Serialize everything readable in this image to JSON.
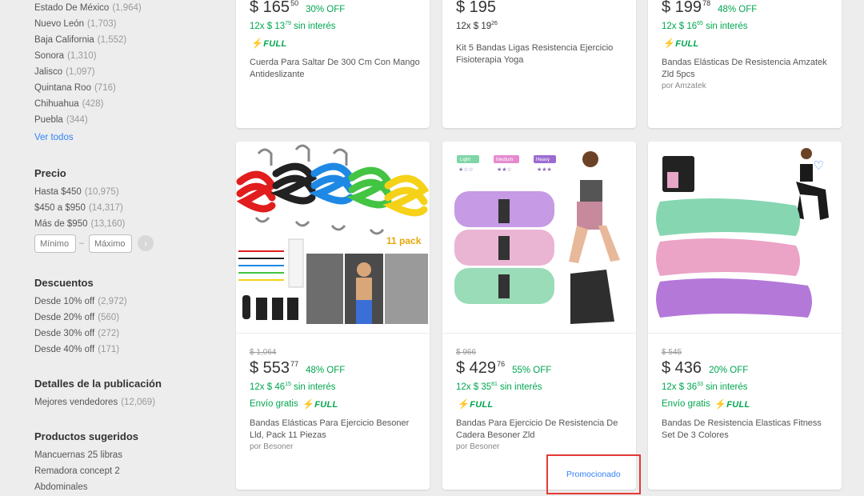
{
  "sidebar": {
    "locations": [
      {
        "label": "Estado De México",
        "count": "(1,964)"
      },
      {
        "label": "Nuevo León",
        "count": "(1,703)"
      },
      {
        "label": "Baja California",
        "count": "(1,552)"
      },
      {
        "label": "Sonora",
        "count": "(1,310)"
      },
      {
        "label": "Jalisco",
        "count": "(1,097)"
      },
      {
        "label": "Quintana Roo",
        "count": "(716)"
      },
      {
        "label": "Chihuahua",
        "count": "(428)"
      },
      {
        "label": "Puebla",
        "count": "(344)"
      }
    ],
    "ver_todos": "Ver todos",
    "precio": {
      "title": "Precio",
      "items": [
        {
          "label": "Hasta $450",
          "count": "(10,975)"
        },
        {
          "label": "$450 a $950",
          "count": "(14,317)"
        },
        {
          "label": "Más de $950",
          "count": "(13,160)"
        }
      ],
      "min_placeholder": "Mínimo",
      "max_placeholder": "Máximo",
      "dash": "–",
      "go_icon": "chevron-right"
    },
    "descuentos": {
      "title": "Descuentos",
      "items": [
        {
          "label": "Desde 10% off",
          "count": "(2,972)"
        },
        {
          "label": "Desde 20% off",
          "count": "(560)"
        },
        {
          "label": "Desde 30% off",
          "count": "(272)"
        },
        {
          "label": "Desde 40% off",
          "count": "(171)"
        }
      ]
    },
    "detalles": {
      "title": "Detalles de la publicación",
      "items": [
        {
          "label": "Mejores vendedores",
          "count": "(12,069)"
        }
      ]
    },
    "sugeridos": {
      "title": "Productos sugeridos",
      "items": [
        {
          "label": "Mancuernas 25 libras"
        },
        {
          "label": "Remadora concept 2"
        },
        {
          "label": "Abdominales"
        }
      ]
    }
  },
  "top_cards": [
    {
      "price": "$ 165",
      "cents": "50",
      "discount": "30% OFF",
      "installments": "12x $ 13",
      "inst_cents": "79",
      "inst_suffix": "sin interés",
      "full": "FULL",
      "title": "Cuerda Para Saltar De 300 Cm Con Mango Antideslizante"
    },
    {
      "price": "$ 195",
      "cents": "",
      "discount": "",
      "installments": "12x $ 19",
      "inst_cents": "26",
      "inst_suffix": "",
      "full": "",
      "title": "Kit 5 Bandas Ligas Resistencia Ejercicio Fisioterapia Yoga"
    },
    {
      "price": "$ 199",
      "cents": "78",
      "discount": "48% OFF",
      "installments": "12x $ 16",
      "inst_cents": "65",
      "inst_suffix": "sin interés",
      "full": "FULL",
      "title": "Bandas Elásticas De Resistencia Amzatek Zld 5pcs",
      "seller": "por Amzatek"
    }
  ],
  "bottom_cards": [
    {
      "orig": "$ 1,064",
      "price": "$ 553",
      "cents": "77",
      "discount": "48% OFF",
      "installments": "12x $ 46",
      "inst_cents": "15",
      "inst_suffix": "sin interés",
      "shipping": "Envío gratis",
      "full": "FULL",
      "title": "Bandas Elásticas Para Ejercicio Besoner Lld, Pack 11 Piezas",
      "seller": "por Besoner",
      "img_text": "11 pack"
    },
    {
      "orig": "$ 966",
      "price": "$ 429",
      "cents": "76",
      "discount": "55% OFF",
      "installments": "12x $ 35",
      "inst_cents": "81",
      "inst_suffix": "sin interés",
      "shipping": "",
      "full": "FULL",
      "title": "Bandas Para Ejercicio De Resistencia De Cadera Besoner Zld",
      "seller": "por Besoner",
      "img_tags": [
        "Light",
        "Medium",
        "Heavy"
      ],
      "promo": "Promocionado"
    },
    {
      "orig": "$ 545",
      "price": "$ 436",
      "cents": "",
      "discount": "20% OFF",
      "installments": "12x $ 36",
      "inst_cents": "33",
      "inst_suffix": "sin interés",
      "shipping": "Envío gratis",
      "full": "FULL",
      "title": "Bandas De Resistencia Elasticas Fitness Set De 3 Colores",
      "fav_icon": "heart-outline"
    }
  ],
  "colors": {
    "green": "#00a650",
    "blue": "#3483fa",
    "highlight": "#e53935",
    "background": "#ededed"
  }
}
